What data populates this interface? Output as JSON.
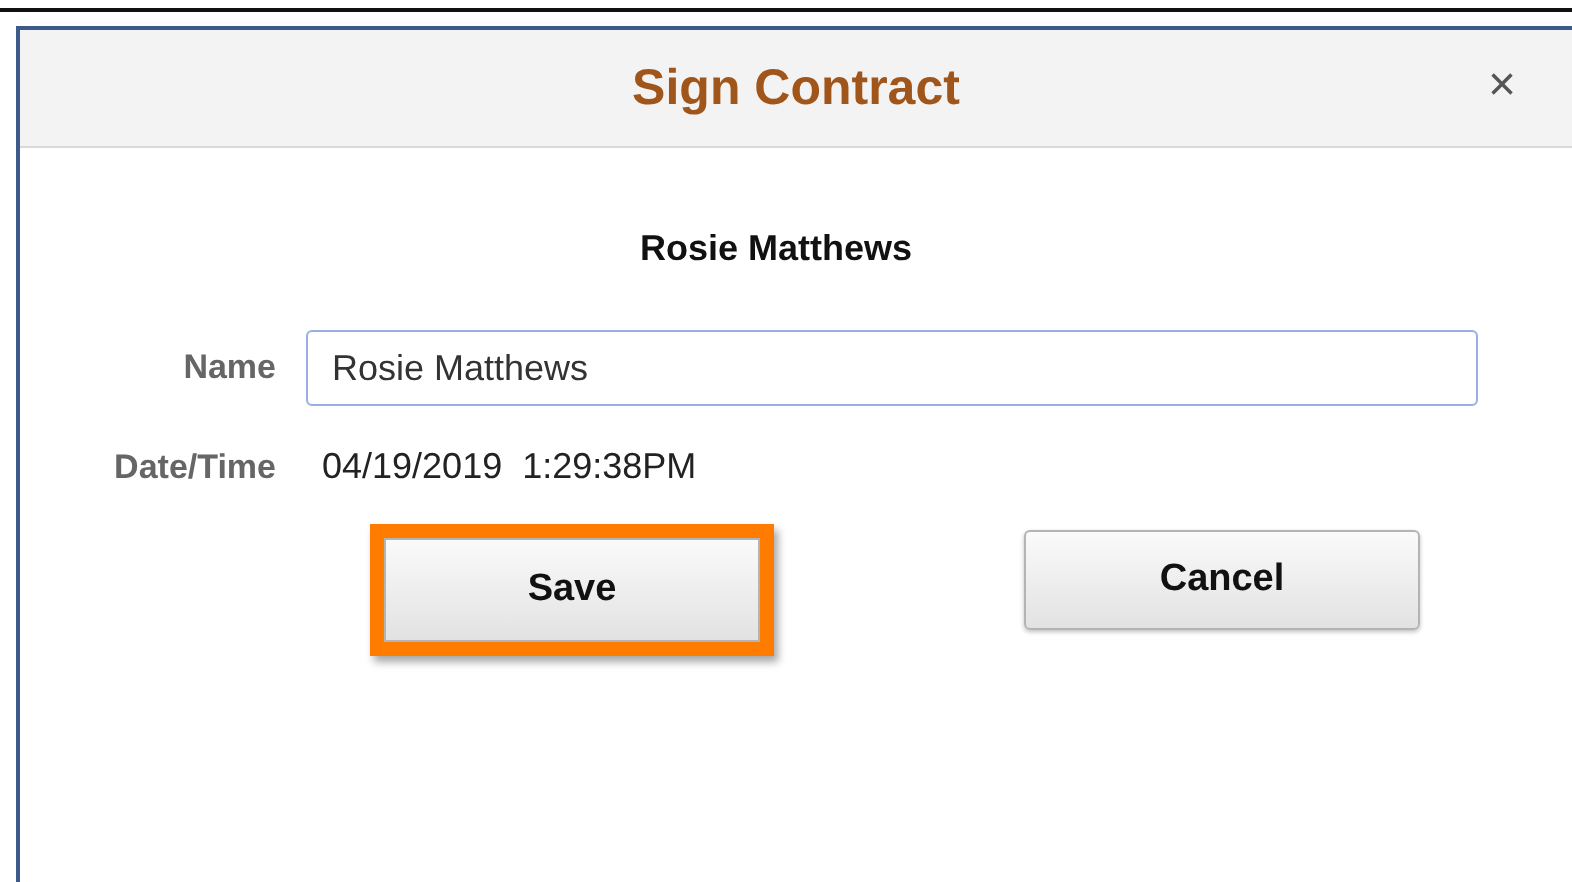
{
  "dialog": {
    "title": "Sign Contract",
    "close": "×"
  },
  "heading": "Rosie Matthews",
  "fields": [
    {
      "label": "Name",
      "kind": "input",
      "value": "Rosie Matthews"
    },
    {
      "label": "Date/Time",
      "kind": "text",
      "value": "04/19/2019  1:29:38PM"
    }
  ],
  "buttons": [
    {
      "label": "Save",
      "highlighted": true
    },
    {
      "label": "Cancel",
      "highlighted": false
    }
  ]
}
